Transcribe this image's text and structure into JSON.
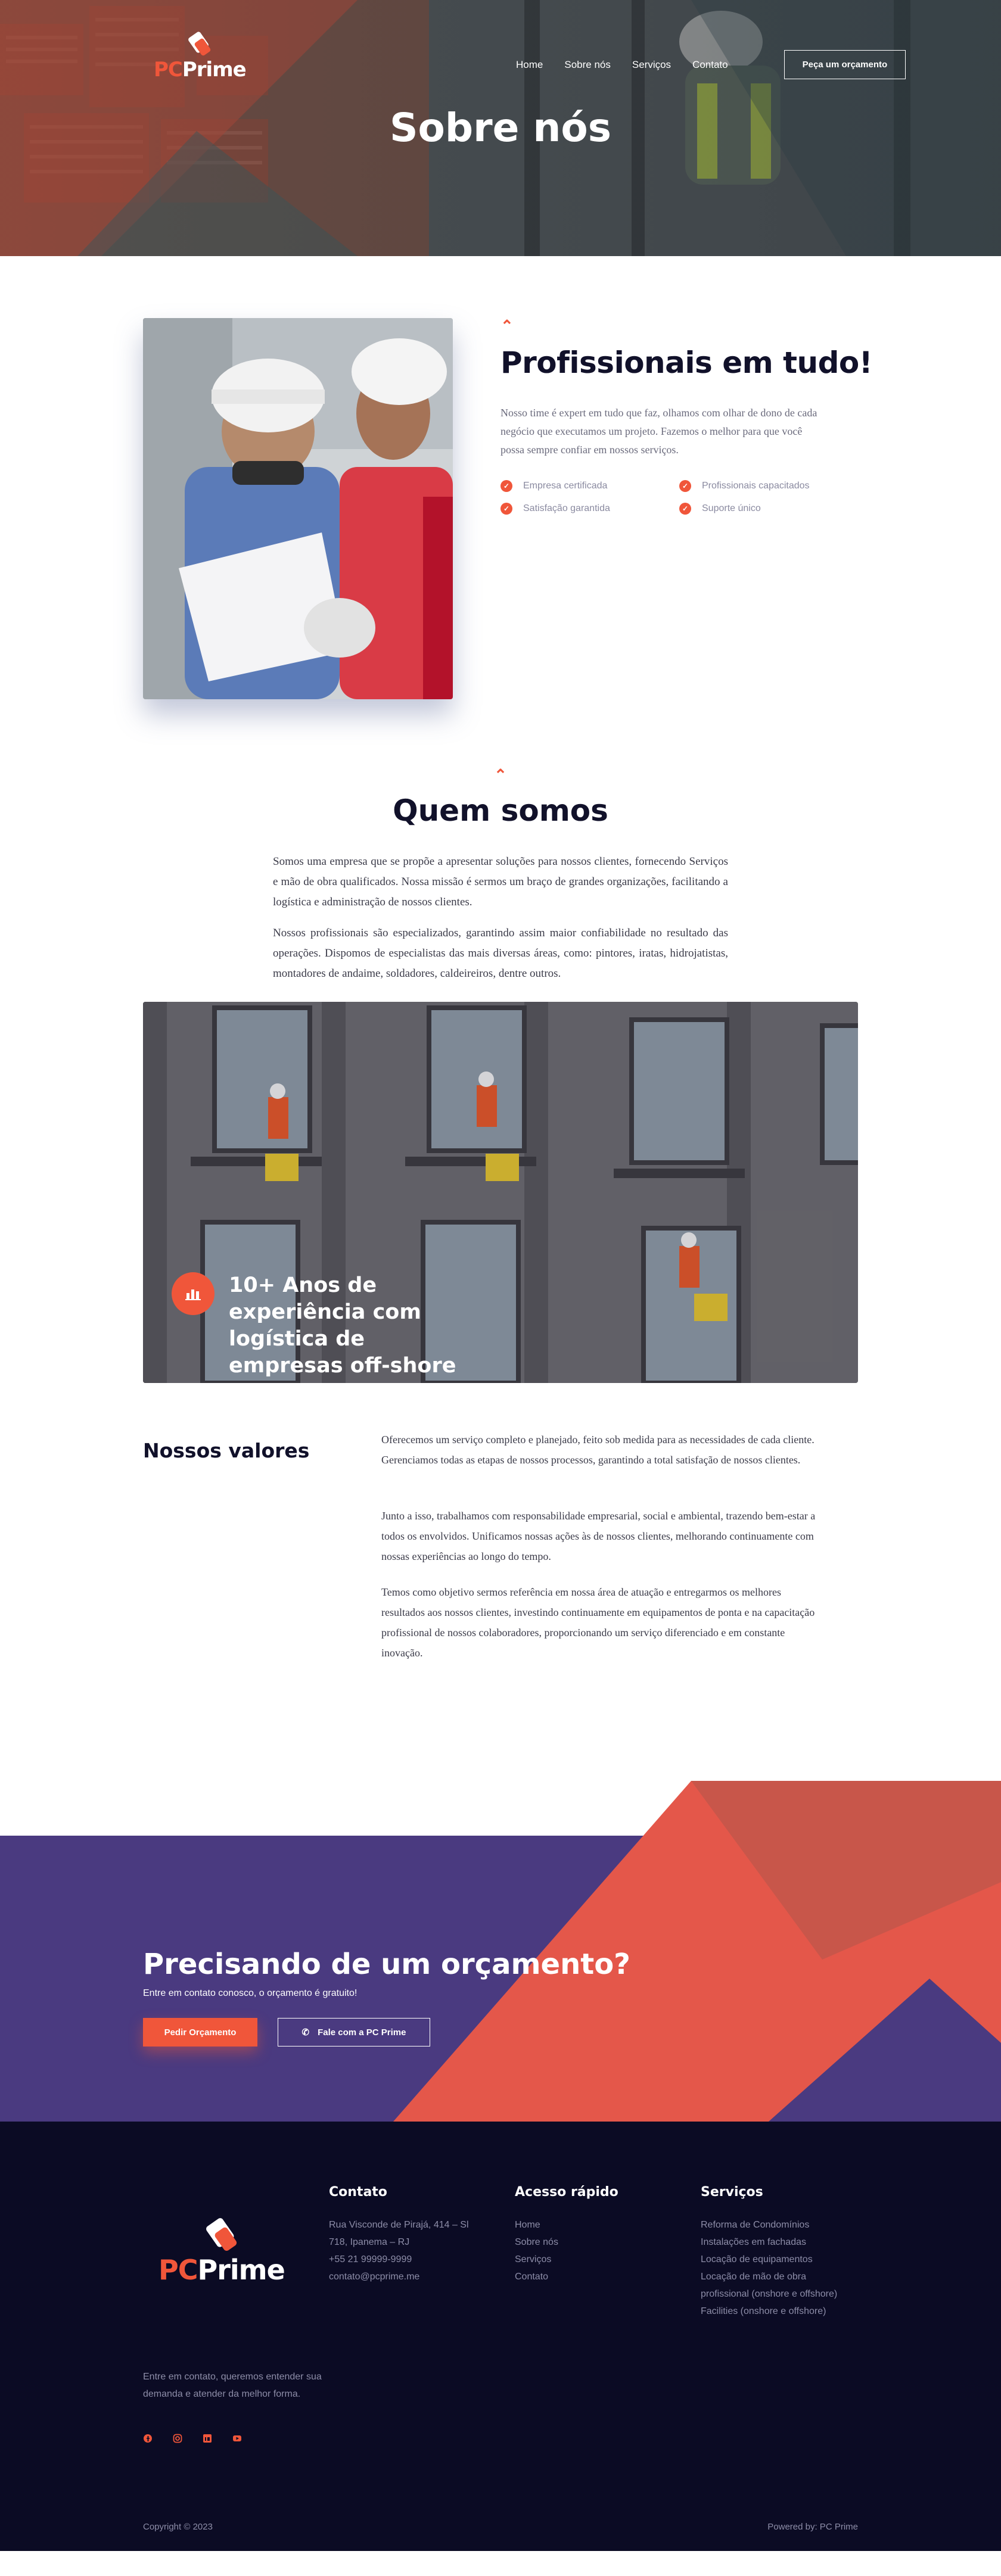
{
  "brand": {
    "pc": "PC",
    "prime": "Prime"
  },
  "nav": {
    "items": [
      "Home",
      "Sobre nós",
      "Serviços",
      "Contato"
    ],
    "cta": "Peça um orçamento"
  },
  "hero": {
    "title": "Sobre nós"
  },
  "professionals": {
    "title": "Profissionais em tudo!",
    "text": "Nosso time é expert em tudo que faz, olhamos com olhar de dono de cada negócio que executamos um projeto. Fazemos o melhor para que você possa sempre confiar em nossos serviços.",
    "features": [
      "Empresa certificada",
      "Profissionais capacitados",
      "Satisfação garantida",
      "Suporte único"
    ]
  },
  "who": {
    "title": "Quem somos",
    "p1": "Somos uma empresa que se propõe a apresentar soluções para nossos clientes, fornecendo Serviços e mão de obra qualificados. Nossa missão é sermos um braço de grandes organizações, facilitando a logística e administração de nossos clientes.",
    "p2": "Nossos profissionais são especializados, garantindo assim maior confiabilidade no resultado das operações. Dispomos de especialistas das mais diversas áreas, como: pintores, iratas, hidrojatistas, montadores de andaime, soldadores, caldeireiros, dentre outros.",
    "banner": "10+ Anos de experiência com logística de empresas off-shore"
  },
  "values": {
    "title": "Nossos valores",
    "p1": "Oferecemos um serviço completo e planejado, feito sob medida para as necessidades de cada cliente. Gerenciamos todas as etapas de nossos processos, garantindo a total satisfação de nossos clientes.",
    "p2": "Junto a isso, trabalhamos com responsabilidade empresarial, social e ambiental, trazendo bem-estar a todos os envolvidos. Unificamos nossas ações às de nossos clientes, melhorando continuamente com nossas experiências ao longo do tempo.",
    "p3": "Temos como objetivo sermos referência em nossa área de atuação e entregarmos os melhores resultados aos nossos clientes, investindo continuamente em equipamentos de ponta e na capacitação profissional de nossos colaboradores, proporcionando um serviço diferenciado e em constante inovação."
  },
  "cta": {
    "title": "Precisando de um orçamento?",
    "subtitle": "Entre em contato conosco, o orçamento é gratuito!",
    "primary": "Pedir Orçamento",
    "secondary": "Fale com a PC Prime"
  },
  "footer": {
    "contact": {
      "title": "Contato",
      "lines": [
        "Rua Visconde de Pirajá, 414 – Sl",
        "718, Ipanema – RJ",
        "+55 21 99999-9999",
        "contato@pcprime.me"
      ]
    },
    "quick": {
      "title": "Acesso rápido",
      "links": [
        "Home",
        "Sobre nós",
        "Serviços",
        "Contato"
      ]
    },
    "services": {
      "title": "Serviços",
      "links": [
        "Reforma de Condomínios",
        "Instalações em fachadas",
        "Locação de equipamentos",
        "Locação de mão de obra",
        "profissional (onshore e offshore)",
        "Facilities (onshore e offshore)"
      ]
    },
    "about": "Entre em contato, queremos entender sua demanda e atender da melhor forma.",
    "socials": [
      "facebook-icon",
      "instagram-icon",
      "linkedin-icon",
      "youtube-icon"
    ],
    "copyright": "Copyright © 2023",
    "powered": "Powered by: PC Prime"
  },
  "colors": {
    "accent": "#f0563a",
    "purple": "#4a3a80",
    "navy": "#0b0b24",
    "coral_light": "#d15a47"
  }
}
